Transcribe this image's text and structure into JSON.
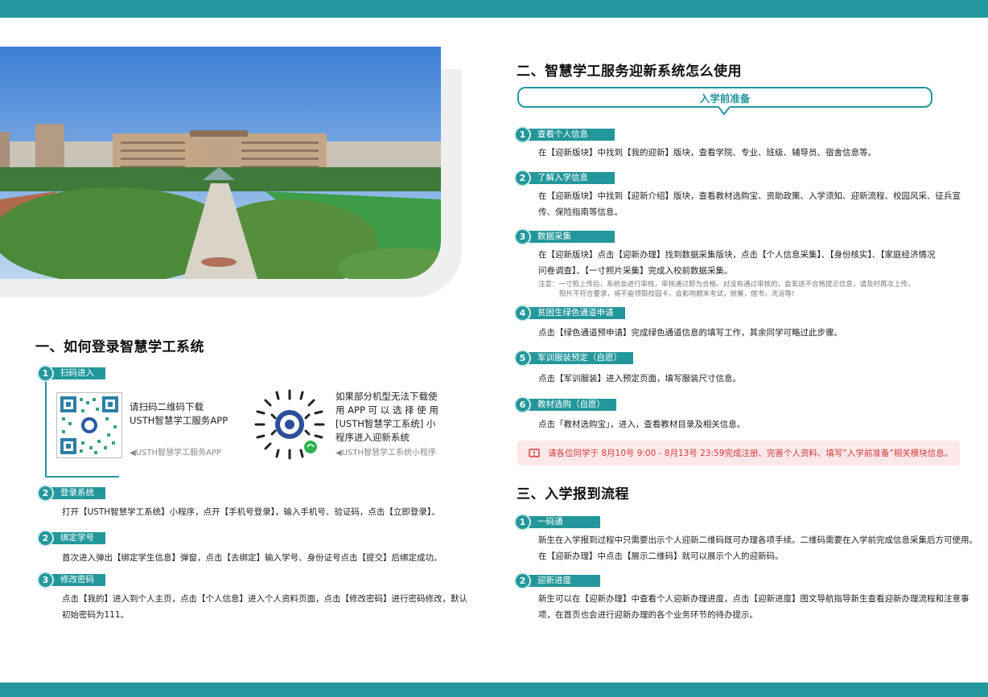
{
  "section1": {
    "title": "一、如何登录智慧学工系统",
    "step1": {
      "num": "1",
      "label": "扫码进入"
    },
    "qr_app": {
      "line1": "请扫码二维码下载",
      "line2": "USTH智慧学工服务APP",
      "caption": "◀USTH智慧学工服务APP"
    },
    "qr_mini": {
      "line1": "如果部分机型无法下载使",
      "line2": "用 APP 可 以 选 择 使 用",
      "line3": "[USTH智慧学工系统] 小",
      "line4": "程序进入迎新系统",
      "caption": "◀USTH智慧学工系统小程序"
    },
    "step2": {
      "num": "2",
      "label": "登录系统",
      "text": "打开【USTH智慧学工系统】小程序，点开【手机号登录】，输入手机号、验证码，点击【立即登录】。"
    },
    "step3": {
      "num": "2",
      "label": "绑定学号",
      "text": "首次进入弹出【绑定学生信息】弹窗，点击【去绑定】输入学号、身份证号点击【提交】后绑定成功。"
    },
    "step4": {
      "num": "3",
      "label": "修改密码",
      "text1": "点击【我的】进入到个人主页，点击【个人信息】进入个人资料页面，点击【修改密码】进行密码修改，默认",
      "text2": "初始密码为111。"
    }
  },
  "section2": {
    "title": "二、智慧学工服务迎新系统怎么使用",
    "banner": "入学前准备",
    "items": [
      {
        "num": "1",
        "label": "查看个人信息",
        "lines": [
          "在【迎新版块】中找到【我的迎新】版块，查看学院、专业、班级、辅导员、宿舍信息等。"
        ]
      },
      {
        "num": "2",
        "label": "了解入学信息",
        "lines": [
          "在【迎新版块】中找到【迎新介绍】版块，查看教材选购宝、资助政策、入学须知、迎新流程、校园风采、征兵宣",
          "传、保险指南等信息。"
        ]
      },
      {
        "num": "3",
        "label": "数据采集",
        "lines": [
          "在【迎新版块】点击【迎新办理】找到数据采集版块，点击【个人信息采集】、【身份核实】、【家庭经济情况",
          "问卷调查】、【一寸照片采集】完成入校前数据采集。"
        ],
        "notes": [
          "注意：一寸照上传后，系统会进行审核，审核通过即为合格。对没有通过审核的，会发送不合格提示信息，请及时再次上传。",
          "照片不符合要求，将不能领取校园卡，会影响期末考试，就餐，借书，洗浴等!"
        ]
      },
      {
        "num": "4",
        "label": "贫困生绿色通道申请",
        "lines": [
          "点击【绿色通道预申请】完成绿色通道信息的填写工作，其余同学可略过此步骤。"
        ]
      },
      {
        "num": "5",
        "label": "军训服装预定（自愿）",
        "lines": [
          "点击【军训服装】进入预定页面，填写服装尺寸信息。"
        ]
      },
      {
        "num": "6",
        "label": "教材选购（自愿）",
        "lines": [
          "点击「教材选购宝」，进入，查看教材目录及相关信息。"
        ]
      }
    ],
    "alert": "请各位同学于 8月10号 9:00 - 8月13号 23:59完成注册、完善个人资料、填写“入学前准备”相关模块信息。"
  },
  "section3": {
    "title": "三、入学报到流程",
    "items": [
      {
        "num": "1",
        "label": "一码通",
        "lines": [
          "新生在入学报到过程中只需要出示个人迎新二维码既可办理各项手续。二维码需要在入学前完成信息采集后方可使用。",
          "在【迎新办理】中点击【展示二维码】就可以展示个人的迎新码。"
        ]
      },
      {
        "num": "2",
        "label": "迎新进度",
        "lines": [
          "新生可以在【迎新办理】中查看个人迎新办理进度，点击【迎新进度】图文导航指导新生查看迎新办理流程和注意事",
          "项，在首页也会进行迎新办理的各个业务环节的待办提示。"
        ]
      }
    ]
  },
  "colors": {
    "accent": "#23979b",
    "alert_bg": "#fce8e8",
    "alert_text": "#d33d3d"
  },
  "icons": {
    "alert": "alert-icon",
    "qr": "qr-code-icon",
    "mini_program": "wechat-mini-program-icon"
  }
}
